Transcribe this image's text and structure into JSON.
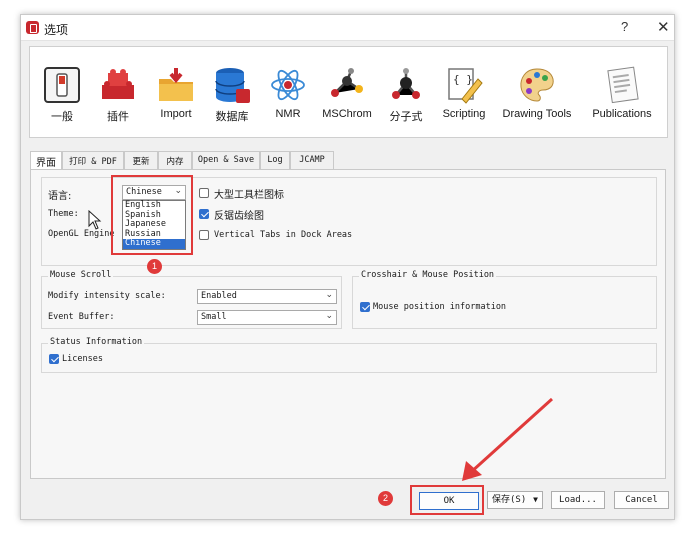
{
  "window": {
    "title": "选项",
    "help": "?",
    "close": "✕"
  },
  "toolbar": [
    {
      "label": "一般",
      "icon": "general-switch-icon"
    },
    {
      "label": "插件",
      "icon": "plugin-bricks-icon"
    },
    {
      "label": "Import",
      "icon": "import-folder-icon"
    },
    {
      "label": "数据库",
      "icon": "database-icon"
    },
    {
      "label": "NMR",
      "icon": "atom-icon"
    },
    {
      "label": "MSChrom",
      "icon": "molecule-chrom-icon"
    },
    {
      "label": "分子式",
      "icon": "molecule-icon"
    },
    {
      "label": "Scripting",
      "icon": "script-pencil-icon"
    },
    {
      "label": "Drawing Tools",
      "icon": "palette-icon"
    },
    {
      "label": "Publications",
      "icon": "newspaper-icon"
    }
  ],
  "tabs": [
    "界面",
    "打印 & PDF",
    "更新",
    "内存",
    "Open & Save",
    "Log",
    "JCAMP"
  ],
  "general": {
    "language_label": "语言:",
    "language_value": "Chinese",
    "language_options": [
      "English",
      "Spanish",
      "Japanese",
      "Russian",
      "Chinese"
    ],
    "theme_label": "Theme:",
    "opengl_label": "OpenGL Engine",
    "large_toolbar_icons": "大型工具栏图标",
    "antialias": "反锯齿绘图",
    "vertical_tabs": "Vertical Tabs in Dock Areas"
  },
  "mouse_scroll": {
    "title": "Mouse Scroll",
    "modify_label": "Modify intensity scale:",
    "modify_value": "Enabled",
    "buffer_label": "Event Buffer:",
    "buffer_value": "Small"
  },
  "crosshair": {
    "title": "Crosshair & Mouse Position",
    "mouse_info": "Mouse position information"
  },
  "status": {
    "title": "Status Information",
    "licenses": "Licenses"
  },
  "buttons": {
    "ok": "OK",
    "save": "保存(S)",
    "load": "Load...",
    "cancel": "Cancel"
  },
  "annotations": {
    "badge1": "1",
    "badge2": "2"
  },
  "colors": {
    "accent": "#2f6fce",
    "highlight": "#e03a3a"
  }
}
